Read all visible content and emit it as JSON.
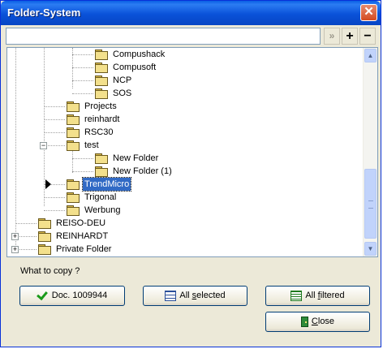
{
  "window": {
    "title": "Folder-System",
    "close_symbol": "✕"
  },
  "toolbar": {
    "search_value": "",
    "go_symbol": "»",
    "expand_symbol": "+",
    "collapse_symbol": "−"
  },
  "tree": {
    "selected_item": "TrendMicro",
    "items": [
      {
        "label": "Compushack",
        "level": 3,
        "expander": ""
      },
      {
        "label": "Compusoft",
        "level": 3,
        "expander": ""
      },
      {
        "label": "NCP",
        "level": 3,
        "expander": ""
      },
      {
        "label": "SOS",
        "level": 3,
        "expander": ""
      },
      {
        "label": "Projects",
        "level": 2,
        "expander": ""
      },
      {
        "label": "reinhardt",
        "level": 2,
        "expander": ""
      },
      {
        "label": "RSC30",
        "level": 2,
        "expander": ""
      },
      {
        "label": "test",
        "level": 2,
        "expander": "−"
      },
      {
        "label": "New Folder",
        "level": 3,
        "expander": ""
      },
      {
        "label": "New Folder (1)",
        "level": 3,
        "expander": ""
      },
      {
        "label": "TrendMicro",
        "level": 2,
        "expander": ""
      },
      {
        "label": "Trigonal",
        "level": 2,
        "expander": ""
      },
      {
        "label": "Werbung",
        "level": 2,
        "expander": ""
      },
      {
        "label": "REISO-DEU",
        "level": 1,
        "expander": ""
      },
      {
        "label": "REINHARDT",
        "level": 1,
        "expander": "+"
      },
      {
        "label": "Private Folder",
        "level": 1,
        "expander": "+"
      }
    ]
  },
  "copy_section": {
    "label": "What to copy ?",
    "doc_button": "Doc. 1009944",
    "all_selected_prefix": "All ",
    "all_selected_underlined": "s",
    "all_selected_suffix": "elected",
    "all_filtered_prefix": "All ",
    "all_filtered_underlined": "f",
    "all_filtered_suffix": "iltered",
    "close_underlined": "C",
    "close_suffix": "lose"
  },
  "icons": {
    "folder": "folder-icon",
    "checkmark": "checkmark-icon",
    "all_selected": "checklist-icon",
    "all_filtered": "list-icon",
    "close": "door-icon"
  },
  "colors": {
    "titlebar": "#0a52d9",
    "selection": "#316ac5",
    "folder": "#f3e08c",
    "window_bg": "#ece9d8"
  }
}
